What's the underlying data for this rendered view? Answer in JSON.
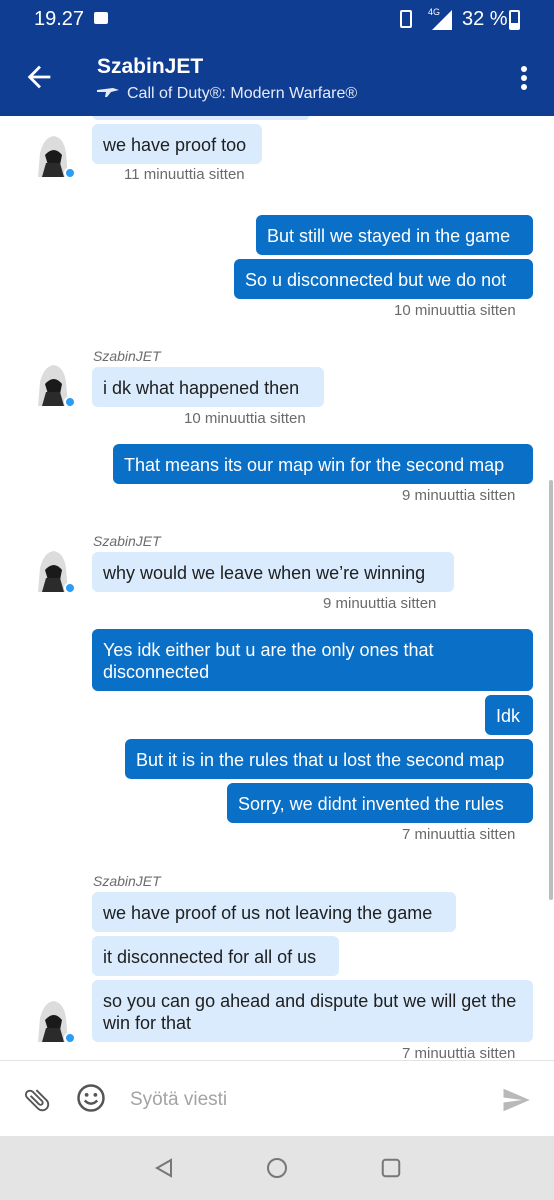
{
  "status_bar": {
    "time": "19.27",
    "network": "4G",
    "battery": "32 %",
    "battery_level": 0.32
  },
  "header": {
    "title": "SzabinJET",
    "subtitle": "Call of Duty®: Modern Warfare®"
  },
  "messages": {
    "m1": {
      "text": "we have proof too",
      "time": "11 minuuttia sitten"
    },
    "m2": {
      "text": "But still we stayed in the game"
    },
    "m3": {
      "text": "So u disconnected but we do not",
      "time": "10 minuuttia sitten"
    },
    "m4": {
      "sender": "SzabinJET",
      "text": "i dk what happened then",
      "time": "10 minuuttia sitten"
    },
    "m5": {
      "text": "That means its our map win for the second map",
      "time": "9 minuuttia sitten"
    },
    "m6": {
      "sender": "SzabinJET",
      "text": "why would we leave when we’re winning",
      "time": "9 minuuttia sitten"
    },
    "m7": {
      "text": "Yes idk either but u are the only ones that disconnected"
    },
    "m8": {
      "text": "Idk"
    },
    "m9": {
      "text": "But it is in the rules that u lost the second map"
    },
    "m10": {
      "text": "Sorry, we didnt invented the rules",
      "time": "7 minuuttia sitten"
    },
    "m11": {
      "sender": "SzabinJET",
      "text": "we have proof of us not leaving the game"
    },
    "m12": {
      "text": "it disconnected for all of us"
    },
    "m13": {
      "text": "so you can go ahead and dispute but we will get the win for that",
      "time": "7 minuuttia sitten"
    }
  },
  "composer": {
    "placeholder": "Syötä viesti"
  },
  "colors": {
    "header_bg": "#0f3d92",
    "outgoing_bubble": "#0a6fc7",
    "incoming_bubble": "#d9ebfd",
    "online_dot": "#2a9df4"
  }
}
